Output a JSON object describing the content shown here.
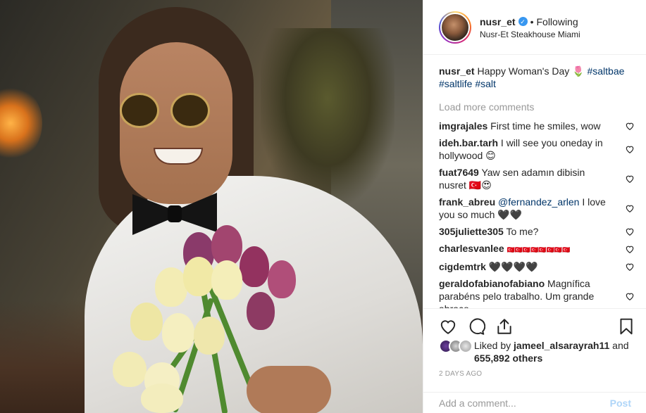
{
  "header": {
    "username": "nusr_et",
    "separator": "•",
    "follow_state": "Following",
    "location": "Nusr-Et Steakhouse Miami"
  },
  "caption": {
    "username": "nusr_et",
    "text": "Happy Woman's Day 🌷",
    "tags": [
      "#saltbae",
      "#saltlife",
      "#salt"
    ]
  },
  "load_more": "Load more comments",
  "comments": [
    {
      "user": "imgrajales",
      "text": "First time he smiles, wow"
    },
    {
      "user": "ideh.bar.tarh",
      "text": "I will see you oneday in hollywood 😊"
    },
    {
      "user": "fuat7649",
      "text": "Yaw sen adamın dibisin nusret 🇹🇷😍"
    },
    {
      "user": "frank_abreu",
      "mention": "@fernandez_arlen",
      "text": "I love you so much 🖤🖤"
    },
    {
      "user": "305juliette305",
      "text": "To me?"
    },
    {
      "user": "charlesvanlee",
      "text": "🇹🇷🇹🇷🇹🇷🇹🇷🇹🇷🇹🇷🇹🇷🇹🇷"
    },
    {
      "user": "cigdemtrk",
      "text": "🖤🖤🖤🖤"
    },
    {
      "user": "geraldofabianofabiano",
      "text": "Magnífica parabéns pelo trabalho. Um grande abraço."
    }
  ],
  "likes": {
    "prefix": "Liked by",
    "user": "jameel_alsarayrah11",
    "conjunction": "and",
    "count": "655,892 others"
  },
  "timestamp": "2 DAYS AGO",
  "add_comment": {
    "placeholder": "Add a comment...",
    "post_label": "Post"
  },
  "colors": {
    "link": "#003569",
    "verified": "#3897f0",
    "muted": "#999999",
    "border": "#efefef"
  },
  "icons": [
    "verified-badge-icon",
    "heart-icon",
    "comment-icon",
    "share-icon",
    "bookmark-icon",
    "like-heart-icon"
  ]
}
